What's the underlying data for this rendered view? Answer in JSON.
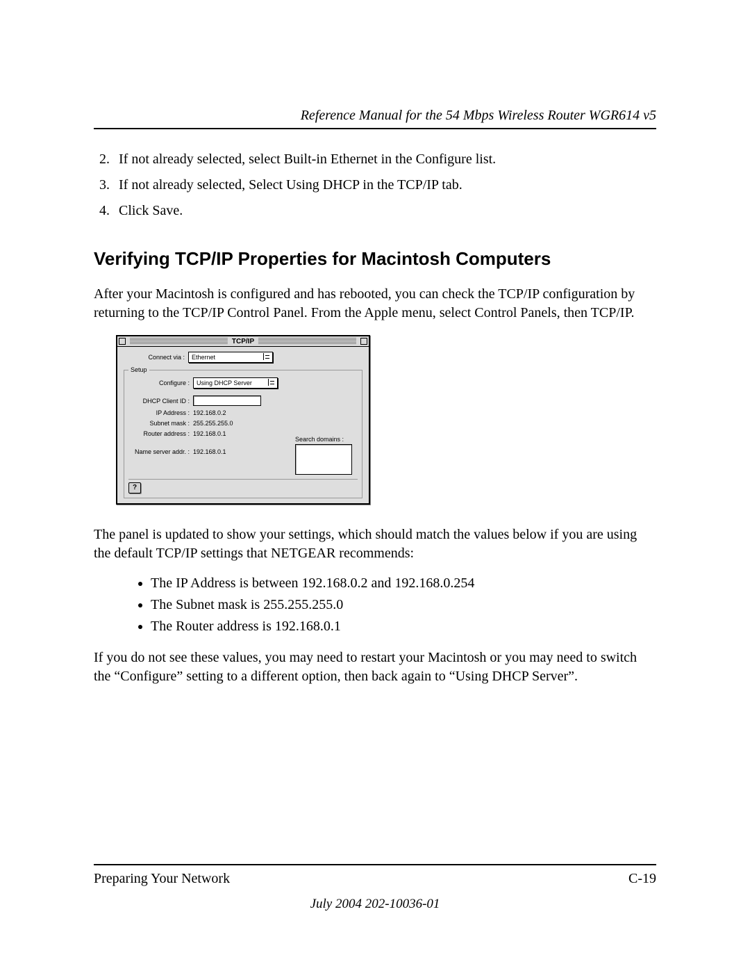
{
  "header": {
    "title": "Reference Manual for the 54 Mbps Wireless Router WGR614 v5"
  },
  "steps": {
    "start": 2,
    "items": [
      "If not already selected, select Built-in Ethernet in the Configure list.",
      "If not already selected, Select Using DHCP in the TCP/IP tab.",
      "Click Save."
    ]
  },
  "section_heading": "Verifying TCP/IP Properties for Macintosh Computers",
  "para1": "After your Macintosh is configured and has rebooted, you can check the TCP/IP configuration by returning to the TCP/IP Control Panel. From the Apple menu, select Control Panels, then TCP/IP.",
  "mac_panel": {
    "title": "TCP/IP",
    "connect_via_label": "Connect via :",
    "connect_via_value": "Ethernet",
    "setup_legend": "Setup",
    "configure_label": "Configure :",
    "configure_value": "Using DHCP Server",
    "dhcp_client_label": "DHCP Client ID :",
    "dhcp_client_value": "",
    "ip_label": "IP Address :",
    "ip_value": "192.168.0.2",
    "subnet_label": "Subnet mask :",
    "subnet_value": "255.255.255.0",
    "router_label": "Router address :",
    "router_value": "192.168.0.1",
    "nameserver_label": "Name server addr. :",
    "nameserver_value": "192.168.0.1",
    "search_domains_label": "Search domains :",
    "help_glyph": "?"
  },
  "para2": "The panel is updated to show your settings, which should match the values below if you are using the default TCP/IP settings that NETGEAR recommends:",
  "bullets": [
    "The IP Address is between 192.168.0.2 and 192.168.0.254",
    "The Subnet mask is 255.255.255.0",
    "The Router address is 192.168.0.1"
  ],
  "para3": "If you do not see these values, you may need to restart your Macintosh or you may need to switch the “Configure” setting to a different option, then back again to “Using DHCP Server”.",
  "footer": {
    "left": "Preparing Your Network",
    "right": "C-19",
    "date": "July 2004 202-10036-01"
  }
}
